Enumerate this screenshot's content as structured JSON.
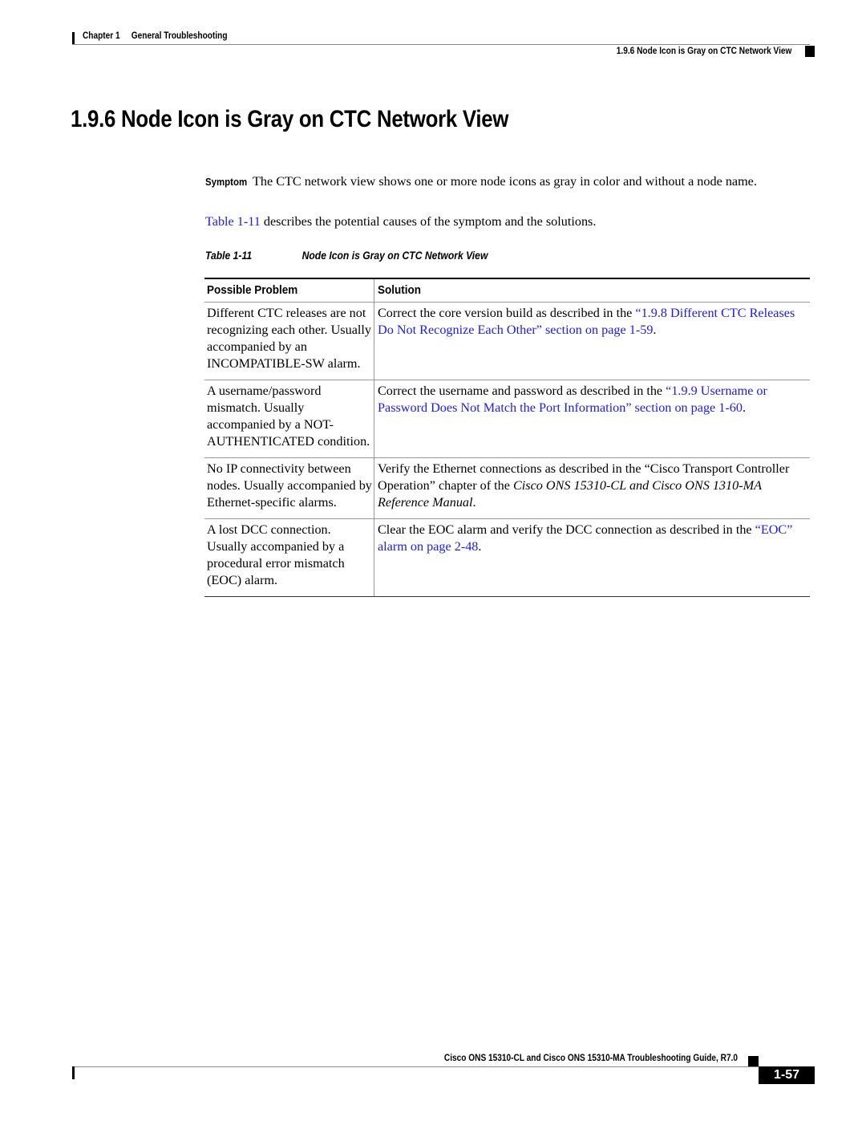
{
  "header": {
    "chapter_label": "Chapter 1",
    "chapter_title": "General Troubleshooting",
    "section_ref": "1.9.6   Node Icon is Gray on CTC Network View"
  },
  "title": "1.9.6  Node Icon is Gray on CTC Network View",
  "symptom": {
    "label": "Symptom",
    "text": "The CTC network view shows one or more node icons as gray in color and without a node name."
  },
  "intro": {
    "link": "Table 1-11",
    "text": " describes the potential causes of the symptom and the solutions."
  },
  "table": {
    "caption_number": "Table 1-11",
    "caption_title": "Node Icon is Gray on CTC Network View",
    "headers": [
      "Possible Problem",
      "Solution"
    ],
    "rows": [
      {
        "problem": "Different CTC releases are not recognizing each other. Usually accompanied by an INCOMPATIBLE-SW alarm.",
        "solution_pre": "Correct the core version build as described in the ",
        "solution_link": "“1.9.8  Different CTC Releases Do Not Recognize Each Other” section on page 1-59",
        "solution_post": "."
      },
      {
        "problem": "A username/password mismatch. Usually accompanied by a NOT-AUTHENTICATED condition.",
        "solution_pre": "Correct the username and password as described in the ",
        "solution_link": "“1.9.9  Username or Password Does Not Match the Port Information” section on page 1-60",
        "solution_post": "."
      },
      {
        "problem": "No IP connectivity between nodes. Usually accompanied by Ethernet-specific alarms.",
        "solution_pre": "Verify the Ethernet connections as described in the “Cisco Transport Controller Operation” chapter of the ",
        "solution_italic": "Cisco ONS 15310-CL and Cisco ONS 1310-MA Reference Manual",
        "solution_post": "."
      },
      {
        "problem": "A lost DCC connection. Usually accompanied by a procedural error mismatch (EOC) alarm.",
        "solution_pre": " Clear the EOC alarm and verify the DCC connection as described in the ",
        "solution_link": "“EOC” alarm on page 2-48",
        "solution_post": "."
      }
    ]
  },
  "footer": {
    "guide_title": "Cisco ONS 15310-CL and Cisco ONS 15310-MA Troubleshooting Guide, R7.0",
    "page_number": "1-57"
  }
}
